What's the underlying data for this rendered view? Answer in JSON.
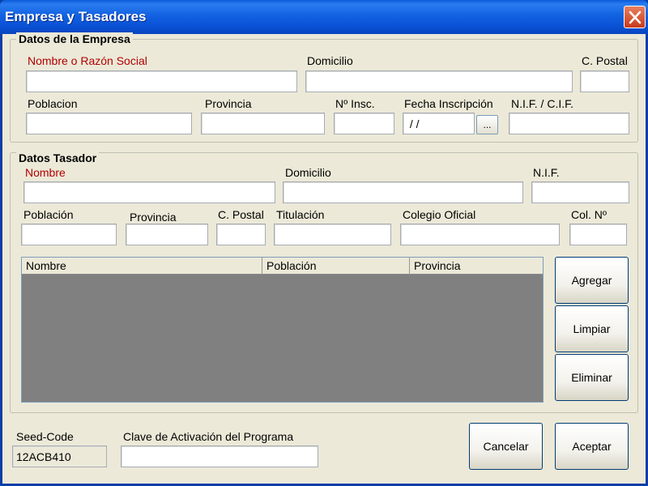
{
  "window": {
    "title": "Empresa y Tasadores"
  },
  "empresa": {
    "legend": "Datos de la Empresa",
    "nombre_label": "Nombre o Razón Social",
    "domicilio_label": "Domicilio",
    "cpostal_label": "C. Postal",
    "poblacion_label": "Poblacion",
    "provincia_label": "Provincia",
    "ninsc_label": "Nº Insc.",
    "fecha_label": "Fecha Inscripción",
    "fecha_value": " / /",
    "fecha_button": "...",
    "nif_label": "N.I.F. / C.I.F."
  },
  "tasador": {
    "legend": "Datos Tasador",
    "nombre_label": "Nombre",
    "domicilio_label": "Domicilio",
    "nif_label": "N.I.F.",
    "poblacion_label": "Población",
    "provincia_label": "Provincia",
    "cpostal_label": "C. Postal",
    "titulacion_label": "Titulación",
    "colegio_label": "Colegio Oficial",
    "colnum_label": "Col. Nº",
    "columns": [
      "Nombre",
      "Población",
      "Provincia"
    ],
    "agregar": "Agregar",
    "limpiar": "Limpiar",
    "eliminar": "Eliminar"
  },
  "footer": {
    "seed_label": "Seed-Code",
    "seed_value": "12ACB410",
    "clave_label": "Clave de Activación del Programa",
    "cancelar": "Cancelar",
    "aceptar": "Aceptar"
  }
}
